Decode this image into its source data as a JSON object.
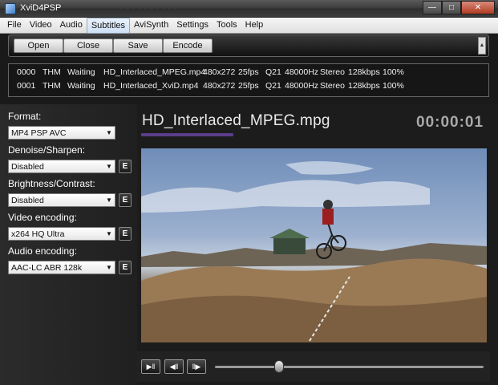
{
  "window": {
    "title": "XviD4PSP",
    "blurred_text": "· · · · · · · · · ·",
    "min_glyph": "—",
    "max_glyph": "□",
    "close_glyph": "✕"
  },
  "menu": [
    "File",
    "Video",
    "Audio",
    "Subtitles",
    "AviSynth",
    "Settings",
    "Tools",
    "Help"
  ],
  "toolbar": {
    "open_label": "Open",
    "close_label": "Close",
    "save_label": "Save",
    "encode_label": "Encode"
  },
  "tasks": [
    {
      "num": "0000",
      "thm": "THM",
      "status": "Waiting",
      "file": "HD_Interlaced_MPEG.mp4",
      "res": "480x272",
      "fps": "25fps",
      "q": "Q21",
      "hz": "48000Hz",
      "ch": "Stereo",
      "br": "128kbps",
      "pct": "100%"
    },
    {
      "num": "0001",
      "thm": "THM",
      "status": "Waiting",
      "file": "HD_Interlaced_XviD.mp4",
      "res": "480x272",
      "fps": "25fps",
      "q": "Q21",
      "hz": "48000Hz",
      "ch": "Stereo",
      "br": "128kbps",
      "pct": "100%"
    }
  ],
  "settings": {
    "format": {
      "label": "Format:",
      "value": "MP4 PSP AVC"
    },
    "denoise": {
      "label": "Denoise/Sharpen:",
      "value": "Disabled",
      "edit": "E"
    },
    "brightness": {
      "label": "Brightness/Contrast:",
      "value": "Disabled",
      "edit": "E"
    },
    "video": {
      "label": "Video encoding:",
      "value": "x264 HQ Ultra",
      "edit": "E"
    },
    "audio": {
      "label": "Audio encoding:",
      "value": "AAC-LC ABR 128k",
      "edit": "E"
    }
  },
  "preview": {
    "filename": "HD_Interlaced_MPEG.mpg",
    "timecode": "00:00:01"
  },
  "player": {
    "play_pause_glyph": "▶‖",
    "frame_back_glyph": "◀‖",
    "frame_forward_glyph": "‖▶",
    "seek_position": 0.24
  },
  "colors": {
    "accent": "#5b3d8c",
    "panel": "#202020"
  }
}
